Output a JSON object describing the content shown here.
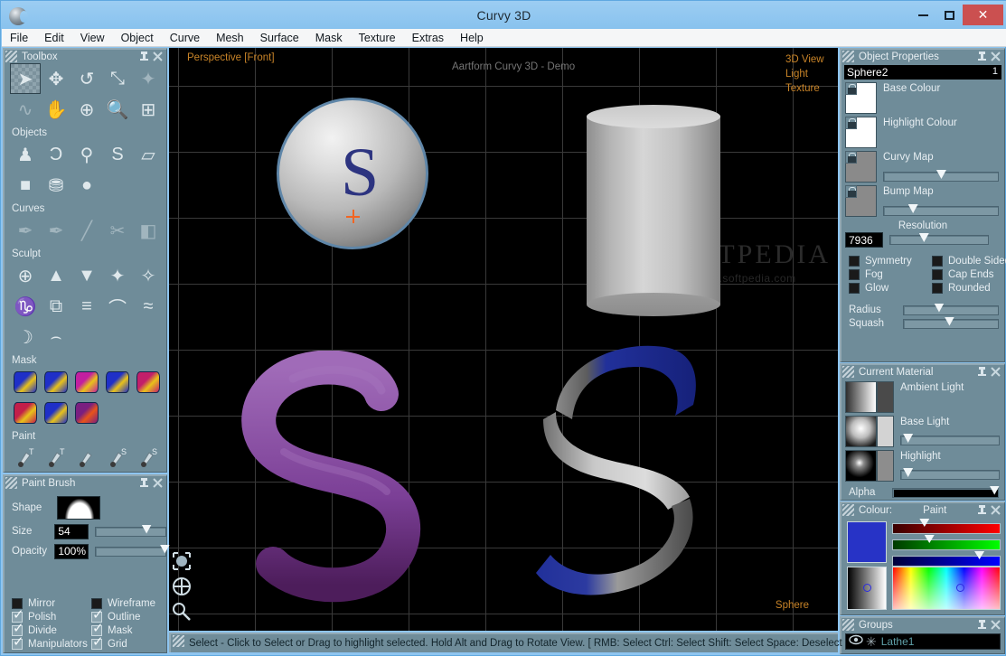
{
  "window": {
    "title": "Curvy 3D",
    "logo_icon": "curvy3d-logo-icon",
    "minimize_label": "–",
    "maximize_label": "□",
    "close_label": "✕",
    "close_color": "#cb5050",
    "titlebar_color": "#8ec5f0"
  },
  "menubar": {
    "items": [
      {
        "label": "File"
      },
      {
        "label": "Edit"
      },
      {
        "label": "View"
      },
      {
        "label": "Object"
      },
      {
        "label": "Curve"
      },
      {
        "label": "Mesh"
      },
      {
        "label": "Surface"
      },
      {
        "label": "Mask"
      },
      {
        "label": "Texture"
      },
      {
        "label": "Extras"
      },
      {
        "label": "Help"
      }
    ]
  },
  "toolbox": {
    "title": "Toolbox",
    "pin_icon": "pin-icon",
    "close_icon": "close-icon",
    "rows": [
      {
        "section": null,
        "icons": [
          {
            "name": "select-tool",
            "glyph": "➤",
            "selected": true,
            "dim": false
          },
          {
            "name": "move-tool",
            "glyph": "✥",
            "selected": false,
            "dim": false
          },
          {
            "name": "rotate-tool",
            "glyph": "↺",
            "selected": false,
            "dim": false
          },
          {
            "name": "scale-tool",
            "glyph": "⤡",
            "selected": false,
            "dim": false
          },
          {
            "name": "deform-tool",
            "glyph": "✦",
            "selected": false,
            "dim": true
          }
        ]
      },
      {
        "section": null,
        "icons": [
          {
            "name": "spline-tool",
            "glyph": "∿",
            "selected": false,
            "dim": true
          },
          {
            "name": "pan-hand-tool",
            "glyph": "✋",
            "selected": false,
            "dim": false
          },
          {
            "name": "orbit-tool",
            "glyph": "⊕",
            "selected": false,
            "dim": false
          },
          {
            "name": "zoom-tool",
            "glyph": "🔍",
            "selected": false,
            "dim": false
          },
          {
            "name": "new-page-tool",
            "glyph": "⊞",
            "selected": false,
            "dim": false
          }
        ]
      },
      {
        "section": "Objects",
        "icons": [
          {
            "name": "lathe-object-tool",
            "glyph": "♟",
            "selected": false,
            "dim": false
          },
          {
            "name": "curve-object-tool",
            "glyph": "Ɔ",
            "selected": false,
            "dim": false
          },
          {
            "name": "tube-object-tool",
            "glyph": "⚲",
            "selected": false,
            "dim": false
          },
          {
            "name": "text-object-tool",
            "glyph": "S",
            "selected": false,
            "dim": false
          },
          {
            "name": "sheet-object-tool",
            "glyph": "▱",
            "selected": false,
            "dim": false
          }
        ]
      },
      {
        "section": null,
        "icons": [
          {
            "name": "cube-primitive-tool",
            "glyph": "■",
            "selected": false,
            "dim": false
          },
          {
            "name": "cylinder-primitive-tool",
            "glyph": "⛃",
            "selected": false,
            "dim": false
          },
          {
            "name": "sphere-primitive-tool",
            "glyph": "●",
            "selected": false,
            "dim": false
          }
        ]
      },
      {
        "section": "Curves",
        "icons": [
          {
            "name": "add-curve-tool",
            "glyph": "✒",
            "selected": false,
            "dim": true
          },
          {
            "name": "edit-curve-tool",
            "glyph": "✒",
            "selected": false,
            "dim": true
          },
          {
            "name": "draw-curve-tool",
            "glyph": "╱",
            "selected": false,
            "dim": true
          },
          {
            "name": "cut-curve-tool",
            "glyph": "✂",
            "selected": false,
            "dim": true
          },
          {
            "name": "extrude-curve-tool",
            "glyph": "◧",
            "selected": false,
            "dim": true
          }
        ]
      },
      {
        "section": "Sculpt",
        "icons": [
          {
            "name": "inflate-sculpt-tool",
            "glyph": "⊕",
            "selected": false,
            "dim": false
          },
          {
            "name": "raise-sculpt-tool",
            "glyph": "▲",
            "selected": false,
            "dim": false
          },
          {
            "name": "lower-sculpt-tool",
            "glyph": "▼",
            "selected": false,
            "dim": false
          },
          {
            "name": "spread-sculpt-tool",
            "glyph": "✦",
            "selected": false,
            "dim": false
          },
          {
            "name": "pinch-sculpt-tool",
            "glyph": "✧",
            "selected": false,
            "dim": false
          }
        ]
      },
      {
        "section": null,
        "icons": [
          {
            "name": "twist-sculpt-tool",
            "glyph": "♑",
            "selected": false,
            "dim": false
          },
          {
            "name": "mirror-sculpt-tool",
            "glyph": "⧉",
            "selected": false,
            "dim": false
          },
          {
            "name": "flatten-sculpt-tool",
            "glyph": "≡",
            "selected": false,
            "dim": false
          },
          {
            "name": "arch-sculpt-tool",
            "glyph": "⌒",
            "selected": false,
            "dim": false
          },
          {
            "name": "ripple-sculpt-tool",
            "glyph": "≈",
            "selected": false,
            "dim": false
          }
        ]
      },
      {
        "section": null,
        "icons": [
          {
            "name": "half-sculpt-tool",
            "glyph": "☽",
            "selected": false,
            "dim": false
          },
          {
            "name": "smooth-sculpt-tool",
            "glyph": "⌢",
            "selected": false,
            "dim": false
          }
        ]
      }
    ],
    "mask_section": "Mask",
    "mask_icons": [
      {
        "name": "mask-square-icon",
        "colors": [
          "#1f30c8",
          "#e8c21a"
        ]
      },
      {
        "name": "mask-moon-icon",
        "colors": [
          "#1f30c8",
          "#e8c21a"
        ]
      },
      {
        "name": "mask-diagonal-icon",
        "colors": [
          "#c21fa0",
          "#e8c21a"
        ]
      },
      {
        "name": "mask-band-icon",
        "colors": [
          "#1f30c8",
          "#e8c21a"
        ]
      },
      {
        "name": "mask-half-icon",
        "colors": [
          "#c21f6a",
          "#e8c21a"
        ]
      },
      {
        "name": "mask-radial-icon",
        "colors": [
          "#c21f4a",
          "#e8c21a"
        ]
      },
      {
        "name": "mask-gradient-icon",
        "colors": [
          "#1f30c8",
          "#e8c21a"
        ]
      },
      {
        "name": "mask-split-icon",
        "colors": [
          "#7a1f80",
          "#e8541a"
        ]
      }
    ],
    "paint_section": "Paint",
    "paint_icons": [
      {
        "name": "paint-brush-texture-icon",
        "badge": "T"
      },
      {
        "name": "paint-airbrush-texture-icon",
        "badge": "T"
      },
      {
        "name": "paint-smudge-icon",
        "badge": ""
      },
      {
        "name": "paint-brush-surface-icon",
        "badge": "S"
      },
      {
        "name": "paint-airbrush-surface-icon",
        "badge": "S"
      }
    ]
  },
  "paint_brush_panel": {
    "title": "Paint Brush",
    "shape_label": "Shape",
    "shape_icon": "bell-curve-brush-icon",
    "size_label": "Size",
    "size_value": "54",
    "size_slider_pct": 82,
    "opacity_label": "Opacity",
    "opacity_value": "100%",
    "opacity_slider_pct": 100,
    "checkboxes": [
      {
        "label": "Mirror",
        "checked": false
      },
      {
        "label": "Wireframe",
        "checked": false
      },
      {
        "label": "Polish",
        "checked": true
      },
      {
        "label": "Outline",
        "checked": true
      },
      {
        "label": "Divide",
        "checked": true
      },
      {
        "label": "Mask",
        "checked": true
      },
      {
        "label": "Manipulators",
        "checked": true
      },
      {
        "label": "Grid",
        "checked": true
      }
    ]
  },
  "viewport": {
    "label": "Perspective [Front]",
    "watermark_demo": "Aartform Curvy 3D - Demo",
    "right_tabs": [
      {
        "label": "3D View"
      },
      {
        "label": "Light"
      },
      {
        "label": "Texture"
      }
    ],
    "selected_object_label": "Sphere",
    "softpedia_main": "SOFTPEDIA",
    "softpedia_sub": "www.softpedia.com",
    "label_color": "#c98428",
    "bottom_tools": [
      {
        "name": "frame-selection-icon"
      },
      {
        "name": "orbit-center-icon"
      },
      {
        "name": "zoom-viewport-icon"
      }
    ],
    "objects": [
      {
        "name": "sphere-object",
        "painted_letter": "S",
        "paint_color": "#2d3480",
        "outline_color": "#5f86a8"
      },
      {
        "name": "cylinder-object"
      },
      {
        "name": "purple-s-tube-object",
        "color": "#7b3f96"
      },
      {
        "name": "ribbon-s-object",
        "color": "#21309a"
      }
    ]
  },
  "object_properties": {
    "title": "Object Properties",
    "name_value": "Sphere2",
    "name_index": "1",
    "rows": [
      {
        "label": "Base Colour",
        "swatch": "#ffffff",
        "has_slider": false
      },
      {
        "label": "Highlight Colour",
        "swatch": "#ffffff",
        "has_slider": false
      },
      {
        "label": "Curvy Map",
        "swatch": "#8a8a8a",
        "has_slider": true,
        "slider_pct": 50
      },
      {
        "label": "Bump Map",
        "swatch": "#8a8a8a",
        "has_slider": true,
        "slider_pct": 23
      }
    ],
    "resolution_label": "Resolution",
    "resolution_value": "7936",
    "resolution_slider_pct": 32,
    "checkboxes": [
      {
        "label": "Symmetry",
        "checked": false
      },
      {
        "label": "Double Sided",
        "checked": false
      },
      {
        "label": "Fog",
        "checked": false
      },
      {
        "label": "Cap Ends",
        "checked": false
      },
      {
        "label": "Glow",
        "checked": false
      },
      {
        "label": "Rounded",
        "checked": false
      }
    ],
    "sliders": [
      {
        "label": "Radius",
        "pct": 35
      },
      {
        "label": "Squash",
        "pct": 47
      }
    ]
  },
  "current_material": {
    "title": "Current Material",
    "rows": [
      {
        "label": "Ambient Light",
        "swatch": "#4a4a4a",
        "has_slider": false
      },
      {
        "label": "Base Light",
        "swatch": "#d3d3d3",
        "has_slider": true,
        "slider_pct": 2
      },
      {
        "label": "Highlight",
        "swatch": "#8d8d8d",
        "has_slider": true,
        "slider_pct": 2
      }
    ],
    "alpha_label": "Alpha",
    "alpha_pct": 100
  },
  "colour_panel": {
    "title": "Colour:",
    "mode": "Paint",
    "current_color": "#2733c6",
    "channels": [
      {
        "name": "red-channel",
        "pct": 27
      },
      {
        "name": "green-channel",
        "pct": 32
      },
      {
        "name": "blue-channel",
        "pct": 83
      }
    ],
    "sv_marker_pct": 50,
    "hue_marker_pct": 66
  },
  "groups_panel": {
    "title": "Groups",
    "items": [
      {
        "name": "Lathe1",
        "visible_icon": "eye-icon",
        "type_icon": "asterisk-icon"
      }
    ]
  },
  "statusbar": {
    "text": "Select - Click to Select or Drag to highlight selected. Hold Alt and Drag to Rotate View. [ RMB: Select   Ctrl: Select   Shift: Select   Space: Deselect"
  }
}
